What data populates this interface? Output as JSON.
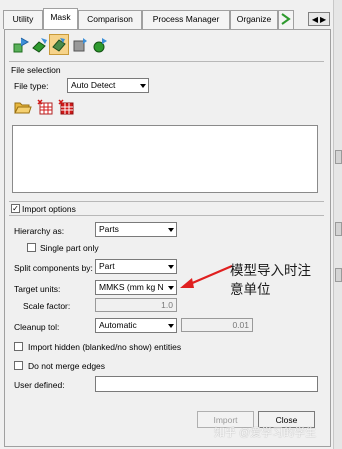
{
  "tabs": [
    {
      "label": "Utility"
    },
    {
      "label": "Mask"
    },
    {
      "label": "Comparison"
    },
    {
      "label": "Process Manager"
    },
    {
      "label": "Organize"
    }
  ],
  "tab_scroll": {
    "left": "◀",
    "right": "▶"
  },
  "file_selection": {
    "section_label": "File selection",
    "file_type_label": "File type:",
    "file_type_value": "Auto Detect"
  },
  "import_options": {
    "section_label": "Import options",
    "section_marker": "✓",
    "hierarchy_label": "Hierarchy as:",
    "hierarchy_value": "Parts",
    "single_part_label": "Single part only",
    "split_label": "Split components by:",
    "split_value": "Part",
    "target_units_label": "Target units:",
    "target_units_value": "MMKS (mm kg N s)",
    "scale_factor_label": "Scale factor:",
    "scale_factor_value": "1.0",
    "cleanup_label": "Cleanup tol:",
    "cleanup_value": "Automatic",
    "cleanup_tol_value": "0.01",
    "import_hidden_label": "Import hidden (blanked/no show) entities",
    "no_merge_label": "Do not merge edges",
    "user_defined_label": "User defined:",
    "user_defined_value": ""
  },
  "buttons": {
    "import": "Import",
    "close": "Close"
  },
  "annotation": {
    "line1": "模型导入时注",
    "line2": "意单位",
    "color": "#e02020"
  },
  "watermark": "知乎 @爱学习的学生",
  "colors": {
    "accent_green": "#2e9a2e",
    "highlight_orange": "#f0c060",
    "red": "#d01818"
  }
}
